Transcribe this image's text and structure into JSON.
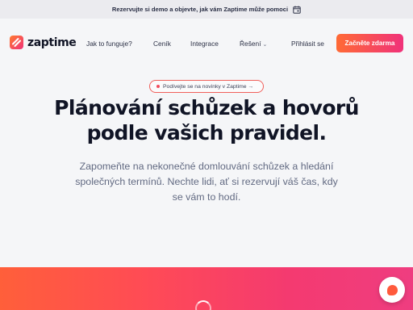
{
  "announcement": {
    "text": "Rezervujte si demo a objevte, jak vám Zaptime může pomoci",
    "icon": "calendar-icon"
  },
  "brand": {
    "name": "zaptime",
    "colors": {
      "primary_start": "#ff6a35",
      "primary_end": "#f0327a",
      "dark": "#101425"
    }
  },
  "nav": {
    "items": [
      {
        "label": "Jak to funguje?"
      },
      {
        "label": "Ceník"
      },
      {
        "label": "Integrace"
      },
      {
        "label": "Řešení",
        "has_dropdown": true
      }
    ],
    "login_label": "Přihlásit se",
    "cta_label": "Začněte zdarma"
  },
  "hero": {
    "pill_text": "Podívejte se na novinky v Zaptime →",
    "headline_line1": "Plánování schůzek a hovorů",
    "headline_line2": "podle vašich pravidel.",
    "subtitle": "Zapomeňte na nekonečné domlouvání schůzek a hledání společných termínů. Nechte lidi, ať si rezervují váš čas, kdy se vám to hodí."
  },
  "chat_widget": {
    "icon": "chat-icon"
  }
}
